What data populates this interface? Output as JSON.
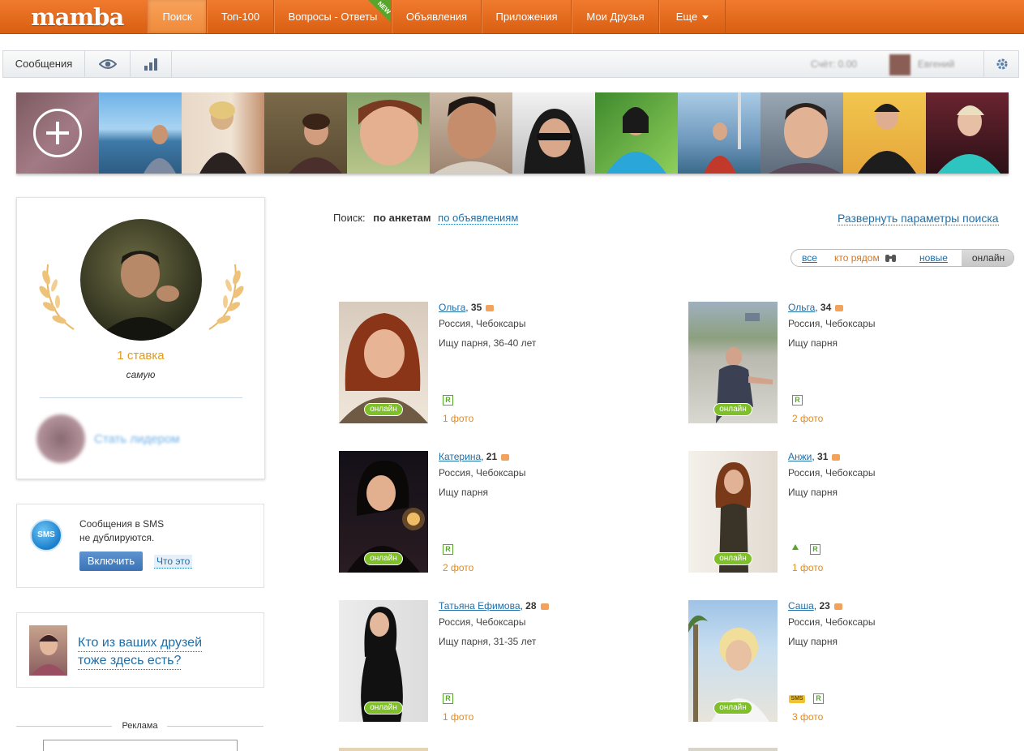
{
  "nav": {
    "logo": "mamba",
    "items": [
      "Поиск",
      "Топ-100",
      "Вопросы - Ответы",
      "Объявления",
      "Приложения",
      "Мои Друзья",
      "Еще"
    ],
    "new_badge": "NEW",
    "accent_color": "#e86d1f"
  },
  "toolbar": {
    "messages": "Сообщения",
    "eye_icon": "eye-icon",
    "stats_icon": "bar-chart-icon",
    "balance": "Счёт: 0.00",
    "username": "Евгений",
    "settings_icon": "gear-icon"
  },
  "left": {
    "bid_count": "1 ставка",
    "bid_label": "самую",
    "leader_link": "Стать лидером",
    "sms_text_1": "Сообщения в SMS",
    "sms_text_2": "не дублируются.",
    "sms_icon_label": "SMS",
    "enable_button": "Включить",
    "what_link": "Что это",
    "friends_link_1": "Кто из ваших друзей",
    "friends_link_2": "тоже здесь есть?",
    "ad_label": "Реклама"
  },
  "search": {
    "label": "Поиск:",
    "by_profiles": "по анкетам",
    "by_ads": "по объявлениям",
    "expand": "Развернуть параметры поиска",
    "filters": [
      "все",
      "кто рядом",
      "новые",
      "онлайн"
    ],
    "active_filter": "онлайн"
  },
  "profiles": [
    {
      "name": "Ольга",
      "age": "35",
      "location": "Россия, Чебоксары",
      "looking": "Ищу парня, 36-40 лет",
      "photos": "1 фото",
      "online": "онлайн",
      "badge": "R"
    },
    {
      "name": "Ольга",
      "age": "34",
      "location": "Россия, Чебоксары",
      "looking": "Ищу парня",
      "photos": "2 фото",
      "online": "онлайн",
      "badge": "R"
    },
    {
      "name": "Катерина",
      "age": "21",
      "location": "Россия, Чебоксары",
      "looking": "Ищу парня",
      "photos": "2 фото",
      "online": "онлайн",
      "badge": "R"
    },
    {
      "name": "Анжи",
      "age": "31",
      "location": "Россия, Чебоксары",
      "looking": "Ищу парня",
      "photos": "1 фото",
      "online": "онлайн",
      "badge": "R"
    },
    {
      "name": "Татьяна Ефимова",
      "age": "28",
      "location": "Россия, Чебоксары",
      "looking": "Ищу парня, 31-35 лет",
      "photos": "1 фото",
      "online": "онлайн",
      "badge": "R"
    },
    {
      "name": "Саша",
      "age": "23",
      "location": "Россия, Чебоксары",
      "looking": "Ищу парня",
      "photos": "3 фото",
      "online": "онлайн",
      "badge": "R",
      "sms": "SMS"
    }
  ]
}
